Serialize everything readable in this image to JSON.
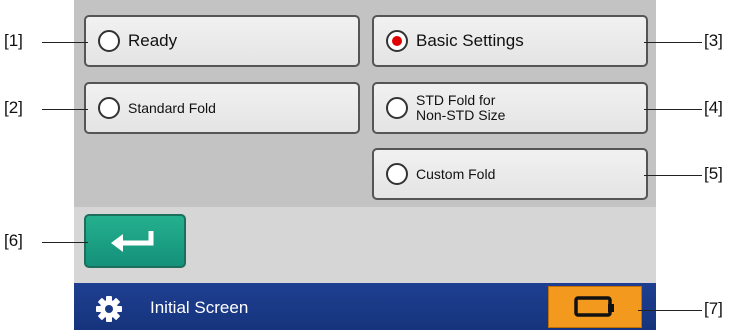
{
  "buttons": {
    "ready": {
      "label": "Ready",
      "selected": false
    },
    "basic_settings": {
      "label": "Basic Settings",
      "selected": true
    },
    "standard_fold": {
      "label": "Standard Fold",
      "selected": false
    },
    "std_fold_line1": "STD Fold for",
    "std_fold_line2": "Non-STD Size",
    "custom_fold": {
      "label": "Custom Fold",
      "selected": false
    }
  },
  "callouts": {
    "c1": "[1]",
    "c2": "[2]",
    "c3": "[3]",
    "c4": "[4]",
    "c5": "[5]",
    "c6": "[6]",
    "c7": "[7]"
  },
  "footer": {
    "title": "Initial Screen",
    "gear_icon": "gear-icon",
    "home_icon": "home-icon"
  },
  "return_button": {
    "icon": "return-arrow-icon"
  },
  "colors": {
    "selected_dot": "#e10000",
    "return_button": "#1aa385",
    "home_button": "#f39a1e",
    "footer_bar": "#1a3a88"
  }
}
